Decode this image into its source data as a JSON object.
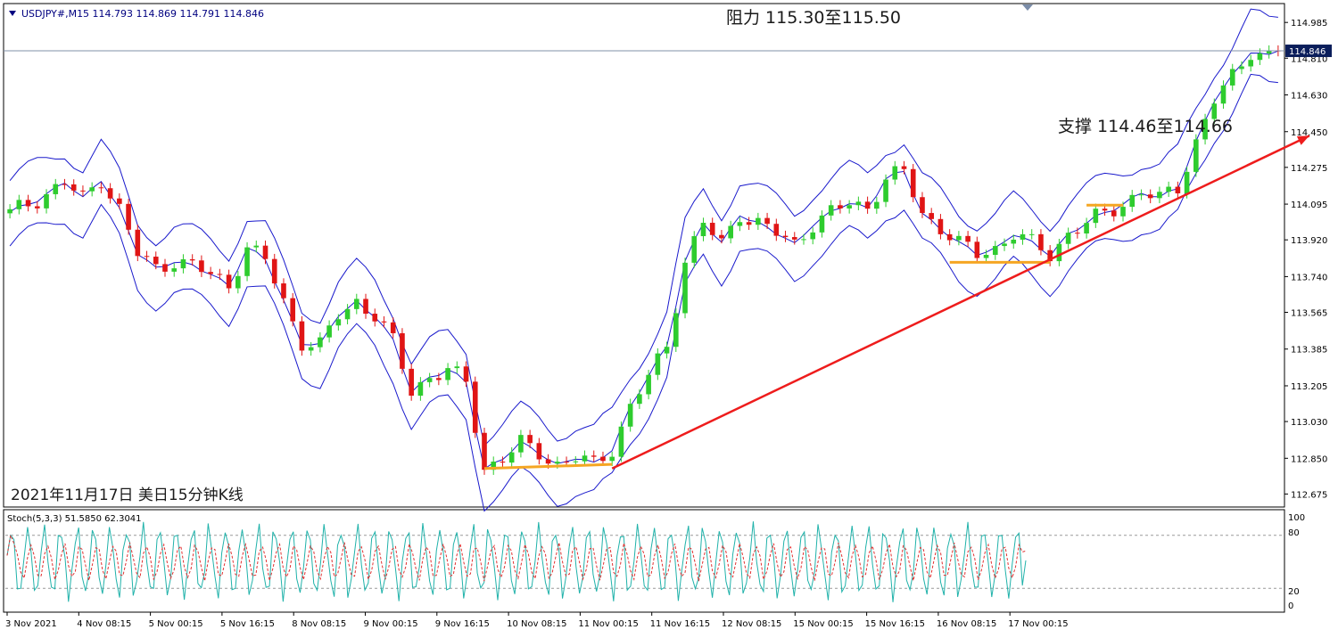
{
  "header": {
    "symbol_info": "USDJPY#,M15  114.793 114.869 114.791 114.846",
    "menu_icon": "triangle-down-icon"
  },
  "annotations": {
    "resistance": "阻力 115.30至115.50",
    "support": "支撑 114.46至114.66",
    "chart_caption": "2021年11月17日 美日15分钟K线"
  },
  "indicator": {
    "label": "Stoch(5,3,3) 51.5850 62.3041",
    "axis_ticks": [
      "100",
      "80",
      "20",
      "0"
    ]
  },
  "colors": {
    "bull_candle": "#2ecc2e",
    "bear_candle": "#e01515",
    "bollinger": "#1a1acc",
    "trendline": "#ee1c1c",
    "support_marker": "#f5a623",
    "stoch_main": "#20b2aa",
    "stoch_signal": "#e03030",
    "current_price_tag": "#0b1e5b"
  },
  "chart_data": {
    "type": "candlestick",
    "symbol": "USDJPY#",
    "timeframe": "M15",
    "ohlc_last": {
      "open": 114.793,
      "high": 114.869,
      "low": 114.791,
      "close": 114.846
    },
    "current_price": 114.846,
    "current_price_label": "114.846",
    "y_ticks": [
      "114.985",
      "114.810",
      "114.630",
      "114.450",
      "114.275",
      "114.095",
      "113.920",
      "113.740",
      "113.565",
      "113.385",
      "113.205",
      "113.030",
      "112.850",
      "112.675"
    ],
    "y_range": [
      112.62,
      115.06
    ],
    "x_ticks": [
      "3 Nov 2021",
      "4 Nov 08:15",
      "5 Nov 00:15",
      "5 Nov 16:15",
      "8 Nov 08:15",
      "9 Nov 00:15",
      "9 Nov 16:15",
      "10 Nov 08:15",
      "11 Nov 00:15",
      "11 Nov 16:15",
      "12 Nov 08:15",
      "15 Nov 00:15",
      "15 Nov 16:15",
      "16 Nov 08:15",
      "17 Nov 00:15"
    ],
    "close_path": [
      [
        0,
        114.05
      ],
      [
        3,
        114.12
      ],
      [
        6,
        114.2
      ],
      [
        8,
        114.12
      ],
      [
        10,
        114.22
      ],
      [
        12,
        114.07
      ],
      [
        14,
        113.85
      ],
      [
        16,
        113.78
      ],
      [
        18,
        113.82
      ],
      [
        20,
        113.79
      ],
      [
        22,
        113.75
      ],
      [
        24,
        113.7
      ],
      [
        26,
        113.88
      ],
      [
        28,
        113.82
      ],
      [
        30,
        113.62
      ],
      [
        32,
        113.42
      ],
      [
        34,
        113.4
      ],
      [
        36,
        113.55
      ],
      [
        38,
        113.62
      ],
      [
        40,
        113.55
      ],
      [
        42,
        113.42
      ],
      [
        44,
        113.18
      ],
      [
        46,
        113.25
      ],
      [
        48,
        113.28
      ],
      [
        50,
        113.22
      ],
      [
        52,
        112.8
      ],
      [
        54,
        112.85
      ],
      [
        56,
        112.92
      ],
      [
        58,
        112.88
      ],
      [
        60,
        112.82
      ],
      [
        62,
        112.85
      ],
      [
        64,
        112.82
      ],
      [
        66,
        112.9
      ],
      [
        68,
        113.1
      ],
      [
        70,
        113.25
      ],
      [
        72,
        113.4
      ],
      [
        74,
        113.82
      ],
      [
        76,
        114.0
      ],
      [
        78,
        113.9
      ],
      [
        80,
        114.05
      ],
      [
        82,
        114.0
      ],
      [
        84,
        113.95
      ],
      [
        86,
        113.9
      ],
      [
        88,
        114.0
      ],
      [
        90,
        114.05
      ],
      [
        92,
        114.1
      ],
      [
        94,
        114.08
      ],
      [
        96,
        114.22
      ],
      [
        98,
        114.25
      ],
      [
        100,
        114.05
      ],
      [
        102,
        113.98
      ],
      [
        104,
        113.9
      ],
      [
        106,
        113.85
      ],
      [
        108,
        113.88
      ],
      [
        110,
        113.95
      ],
      [
        112,
        113.9
      ],
      [
        114,
        113.85
      ],
      [
        116,
        113.95
      ],
      [
        118,
        114.0
      ],
      [
        120,
        114.05
      ],
      [
        122,
        114.1
      ],
      [
        124,
        114.15
      ],
      [
        126,
        114.12
      ],
      [
        128,
        114.18
      ],
      [
        130,
        114.4
      ],
      [
        132,
        114.6
      ],
      [
        134,
        114.72
      ],
      [
        136,
        114.85
      ],
      [
        138,
        114.82
      ],
      [
        139,
        114.846
      ]
    ],
    "x_count": 140,
    "bb_width": 0.16,
    "trendline": {
      "from": [
        66,
        112.8
      ],
      "to": [
        139,
        114.43
      ],
      "extends_to_label": "support",
      "arrow": true
    },
    "support_segments": [
      {
        "from": [
          52,
          112.8
        ],
        "to": [
          66,
          112.82
        ]
      },
      {
        "from": [
          103,
          113.81
        ],
        "to": [
          114,
          113.81
        ]
      },
      {
        "from": [
          118,
          114.09
        ],
        "to": [
          122,
          114.09
        ]
      }
    ],
    "stoch_cycles": 62,
    "stoch_levels": [
      80,
      20
    ],
    "stoch_last": {
      "main": 51.585,
      "signal": 62.3041
    }
  }
}
